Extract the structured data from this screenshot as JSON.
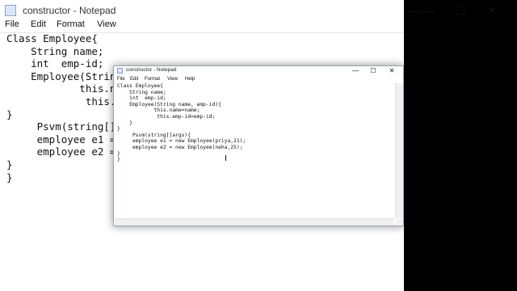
{
  "window": {
    "title": "constructor - Notepad",
    "controls": {
      "minimize": "—",
      "maximize": "☐",
      "close": "✕"
    }
  },
  "menu": [
    "File",
    "Edit",
    "Format",
    "View",
    "Help"
  ],
  "code": "Class Employee{\n    String name;\n    int  emp-id;\n    Employee(String name, emp-id){\n            this.name=name;\n             this.emp-id=emp-id;\n    }\n}\n     Psvm(string[]args){\n     employee e1 = new Employee(priya,21);\n     employee e2 = new Employee(neha,25);\n}\n}",
  "background": {
    "title": "constructor - Notepad",
    "menu": [
      "File",
      "Edit",
      "Format",
      "View"
    ],
    "code": "Class Employee{\n    String name;\n    int  emp-id;\n    Employee(String\n            this.na\n             this.e\n}\n     Psvm(string[]\n     employee e1 =\n     employee e2 =\n}\n}"
  }
}
